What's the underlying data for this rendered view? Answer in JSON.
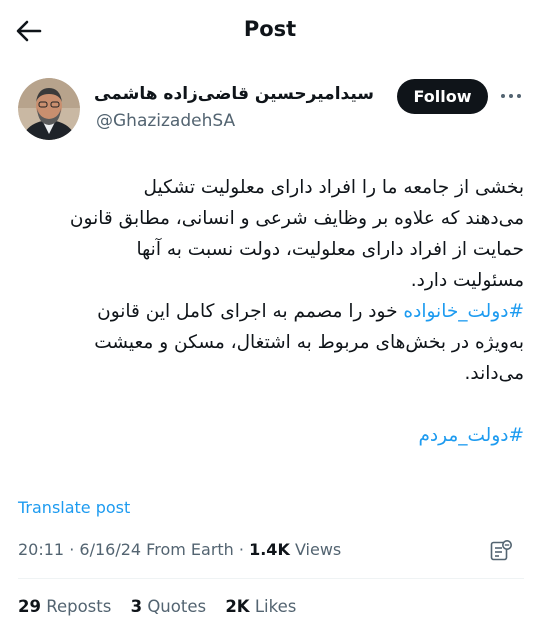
{
  "header": {
    "back_icon": "arrow-left-icon",
    "title": "Post"
  },
  "author": {
    "avatar_icon": "avatar-photo",
    "name": "سیدامیرحسین قاضی‌زاده هاشمی",
    "handle": "@GhazizadehSA"
  },
  "follow_label": "Follow",
  "more_icon": "more-horizontal-icon",
  "tweet": {
    "lines": [
      "بخشی از جامعه ما را افراد دارای معلولیت تشکیل",
      "می‌دهند که علاوه بر وظایف شرعی و انسانی، مطابق قانون",
      "حمایت از افراد دارای معلولیت، دولت نسبت به آنها",
      "مسئولیت دارد."
    ],
    "hashtag1": "#دولت_خانواده",
    "line5_rest": " خود را مصمم به اجرای کامل این قانون",
    "lines_after": [
      "به‌ویژه در بخش‌های مربوط به اشتغال، مسکن و معیشت",
      "می‌داند."
    ],
    "hashtag2": "#دولت_مردم"
  },
  "translate_label": "Translate post",
  "meta": {
    "time": "20:11",
    "date": "6/16/24",
    "source": "From Earth",
    "separator": "·",
    "views_count": "1.4K",
    "views_label": "Views",
    "analytics_icon": "analytics-icon"
  },
  "stats": {
    "reposts_count": "29",
    "reposts_label": "Reposts",
    "quotes_count": "3",
    "quotes_label": "Quotes",
    "likes_count": "2K",
    "likes_label": "Likes"
  }
}
